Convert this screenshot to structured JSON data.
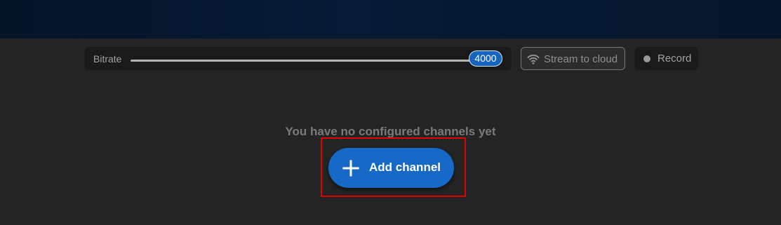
{
  "toolbar": {
    "bitrate": {
      "label": "Bitrate",
      "value": "4000",
      "fill_fraction": 0.92
    },
    "stream_to_cloud": {
      "label": "Stream to cloud",
      "icon": "wifi-icon"
    },
    "record": {
      "label": "Record",
      "icon": "record-dot-icon"
    }
  },
  "main": {
    "empty_message": "You have no configured channels yet",
    "add_channel": {
      "label": "Add channel",
      "icon": "plus-icon"
    }
  },
  "colors": {
    "accent": "#1769c8",
    "highlight": "#e00000",
    "background": "#242424"
  }
}
